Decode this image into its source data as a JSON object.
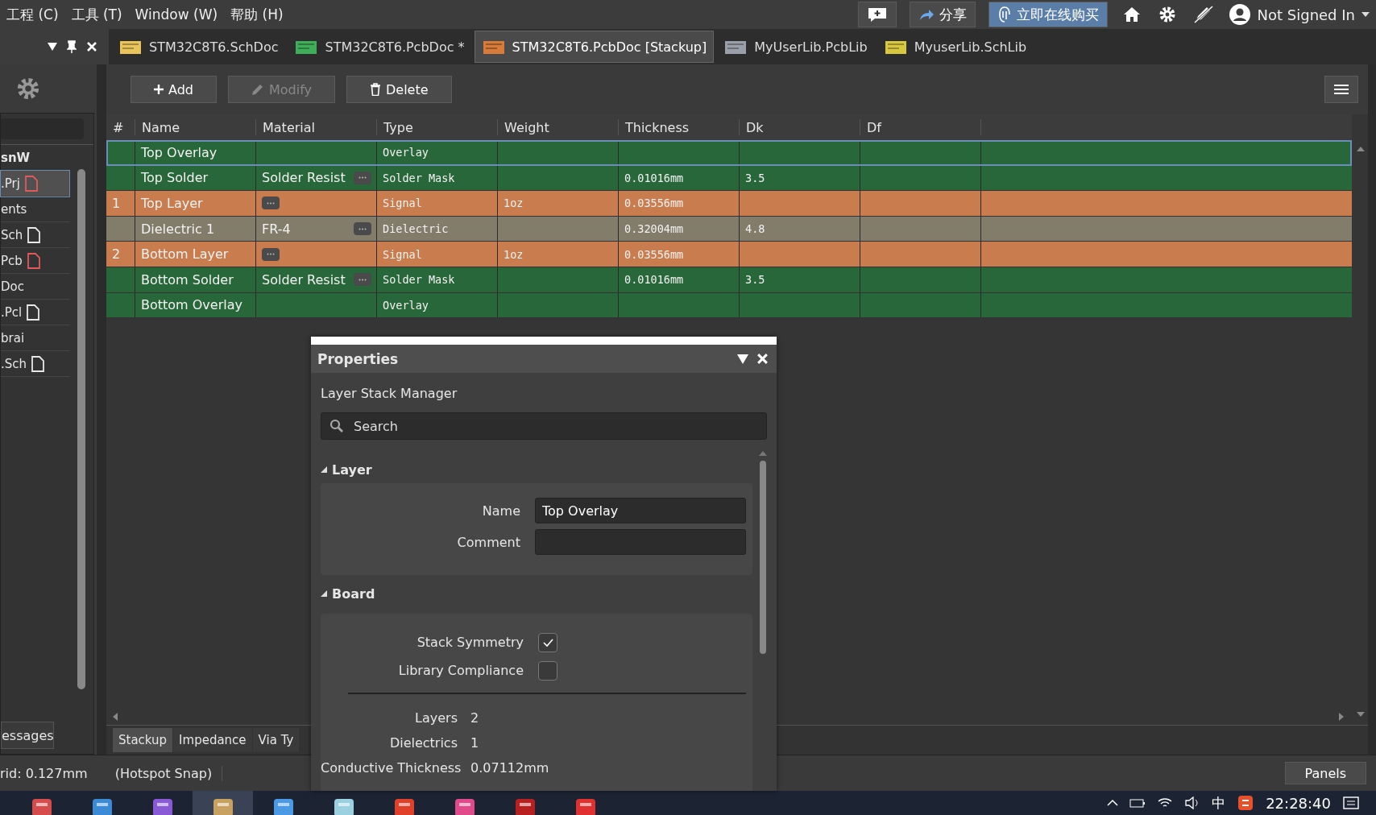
{
  "menu": [
    "工程 (C)",
    "工具 (T)",
    "Window (W)",
    "帮助 (H)"
  ],
  "topbar": {
    "share": "分享",
    "buy": "立即在线购买",
    "user": "Not Signed In"
  },
  "doc_tabs": [
    {
      "label": "STM32C8T6.SchDoc",
      "kind": "sch",
      "selected": false
    },
    {
      "label": "STM32C8T6.PcbDoc *",
      "kind": "pcb",
      "selected": false
    },
    {
      "label": "STM32C8T6.PcbDoc [Stackup]",
      "kind": "stack",
      "selected": true
    },
    {
      "label": "MyUserLib.PcbLib",
      "kind": "pcblib",
      "selected": false
    },
    {
      "label": "MyuserLib.SchLib",
      "kind": "schlib",
      "selected": false
    }
  ],
  "project_panel": {
    "header": "snW",
    "items": [
      {
        "label": ".Prj",
        "color": "#e05a5a",
        "selected": true
      },
      {
        "label": "ents",
        "selected": false
      },
      {
        "label": "Sch",
        "color": "#e8e8e8",
        "selected": false
      },
      {
        "label": "Pcb",
        "color": "#e05a5a",
        "selected": false
      },
      {
        "label": "Doc",
        "selected": false
      },
      {
        "label": ".Pcl",
        "color": "#e8e8e8",
        "selected": false
      },
      {
        "label": "brai",
        "selected": false
      },
      {
        "label": ".Sch",
        "color": "#e8e8e8",
        "selected": false
      }
    ],
    "bottom_tab": "essages"
  },
  "toolbar": {
    "add": "Add",
    "modify": "Modify",
    "delete": "Delete"
  },
  "table": {
    "columns": [
      "#",
      "Name",
      "Material",
      "Type",
      "Weight",
      "Thickness",
      "Dk",
      "Df"
    ],
    "rows": [
      {
        "kind": "overlay",
        "selected": true,
        "num": "",
        "name": "Top Overlay",
        "material": "",
        "dots": false,
        "type": "Overlay",
        "weight": "",
        "thickness": "",
        "dk": ""
      },
      {
        "kind": "mask",
        "selected": false,
        "num": "",
        "name": "Top Solder",
        "material": "Solder Resist",
        "dots": true,
        "type": "Solder Mask",
        "weight": "",
        "thickness": "0.01016mm",
        "dk": "3.5"
      },
      {
        "kind": "signal",
        "selected": false,
        "num": "1",
        "name": "Top Layer",
        "material": "",
        "dots": true,
        "type": "Signal",
        "weight": "1oz",
        "thickness": "0.03556mm",
        "dk": ""
      },
      {
        "kind": "dielectric",
        "selected": false,
        "num": "",
        "name": "Dielectric 1",
        "material": "FR-4",
        "dots": true,
        "type": "Dielectric",
        "weight": "",
        "thickness": "0.32004mm",
        "dk": "4.8"
      },
      {
        "kind": "signal",
        "selected": false,
        "num": "2",
        "name": "Bottom Layer",
        "material": "",
        "dots": true,
        "type": "Signal",
        "weight": "1oz",
        "thickness": "0.03556mm",
        "dk": ""
      },
      {
        "kind": "mask",
        "selected": false,
        "num": "",
        "name": "Bottom Solder",
        "material": "Solder Resist",
        "dots": true,
        "type": "Solder Mask",
        "weight": "",
        "thickness": "0.01016mm",
        "dk": "3.5"
      },
      {
        "kind": "overlay",
        "selected": false,
        "num": "",
        "name": "Bottom Overlay",
        "material": "",
        "dots": false,
        "type": "Overlay",
        "weight": "",
        "thickness": "",
        "dk": ""
      }
    ]
  },
  "bottom_tabs": [
    {
      "label": "Stackup",
      "selected": true
    },
    {
      "label": "Impedance",
      "selected": false
    },
    {
      "label": "Via Ty",
      "selected": false
    }
  ],
  "properties": {
    "title": "Properties",
    "subtitle": "Layer Stack Manager",
    "search": {
      "placeholder": "Search"
    },
    "layer": {
      "title": "Layer",
      "name_label": "Name",
      "name_value": "Top Overlay",
      "comment_label": "Comment"
    },
    "board": {
      "title": "Board",
      "checks": [
        {
          "label": "Stack Symmetry",
          "checked": true
        },
        {
          "label": "Library Compliance",
          "checked": false
        }
      ],
      "stats": [
        {
          "label": "Layers",
          "value": "2"
        },
        {
          "label": "Dielectrics",
          "value": "1"
        },
        {
          "label": "Conductive Thickness",
          "value": "0.07112mm"
        }
      ]
    }
  },
  "status_bar": {
    "grid": "rid: 0.127mm",
    "snap": "(Hotspot Snap)",
    "panels": "Panels"
  },
  "taskbar": {
    "ime": "中",
    "time": "22:28:40"
  }
}
